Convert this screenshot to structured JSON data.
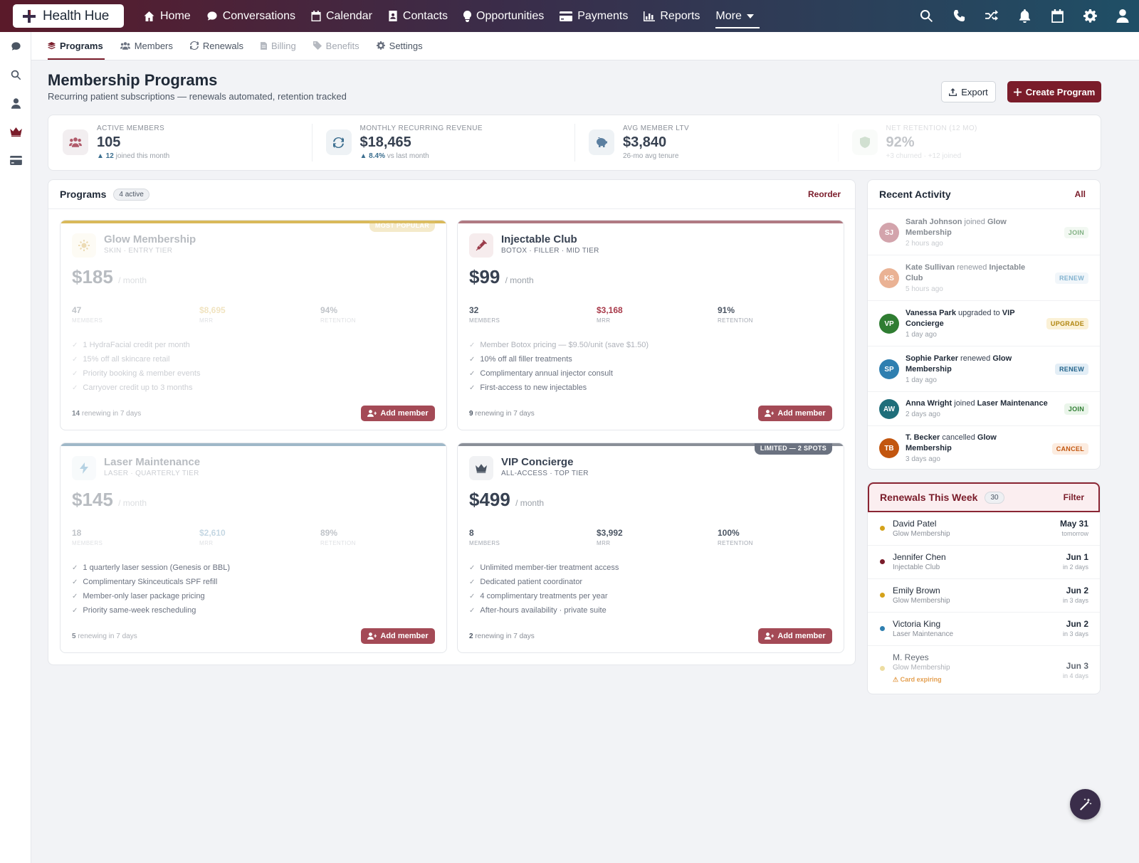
{
  "brand": {
    "name": "Health Hue"
  },
  "nav": {
    "items": [
      {
        "label": "Home",
        "icon": "home-icon"
      },
      {
        "label": "Conversations",
        "icon": "chat-icon"
      },
      {
        "label": "Calendar",
        "icon": "calendar-icon"
      },
      {
        "label": "Contacts",
        "icon": "contacts-icon"
      },
      {
        "label": "Opportunities",
        "icon": "lightbulb-icon"
      },
      {
        "label": "Payments",
        "icon": "credit-card-icon"
      },
      {
        "label": "Reports",
        "icon": "chart-icon"
      }
    ],
    "more": "More"
  },
  "subnav": {
    "items": [
      {
        "label": "Programs",
        "state": "active"
      },
      {
        "label": "Members",
        "state": "normal"
      },
      {
        "label": "Renewals",
        "state": "normal"
      },
      {
        "label": "Billing",
        "state": "disabled"
      },
      {
        "label": "Benefits",
        "state": "disabled"
      },
      {
        "label": "Settings",
        "state": "normal"
      }
    ]
  },
  "header": {
    "title": "Membership Programs",
    "subtitle": "Recurring patient subscriptions — renewals automated, retention tracked",
    "export_label": "Export",
    "create_label": "Create Program"
  },
  "stats": [
    {
      "label": "ACTIVE MEMBERS",
      "value": "105",
      "delta": "▲ 12",
      "note": "joined this month"
    },
    {
      "label": "MONTHLY RECURRING REVENUE",
      "value": "$18,465",
      "delta": "▲ 8.4%",
      "note": "vs last month"
    },
    {
      "label": "AVG MEMBER LTV",
      "value": "$3,840",
      "delta": "",
      "note": "26-mo avg tenure"
    },
    {
      "label": "NET RETENTION (12 MO)",
      "value": "92%",
      "delta": "",
      "note": "+3 churned · +12 joined"
    }
  ],
  "programs": {
    "title": "Programs",
    "badge": "4 active",
    "reorder": "Reorder",
    "add_label": "Add member",
    "metric_labels": {
      "members": "MEMBERS",
      "mrr": "MRR",
      "retention": "RETENTION"
    },
    "per": "/ month",
    "renewing_suffix": "renewing in 7 days",
    "cards": [
      {
        "name": "Glow Membership",
        "tier": "SKIN · ENTRY TIER",
        "price": "$185",
        "members": "47",
        "mrr": "$8,695",
        "retention": "94%",
        "renewing": "14",
        "ribbon": "MOST POPULAR",
        "accent": "#d9b95a",
        "benefits": [
          "1 HydraFacial credit per month",
          "15% off all skincare retail",
          "Priority booking & member events",
          "Carryover credit up to 3 months"
        ]
      },
      {
        "name": "Injectable Club",
        "tier": "BOTOX · FILLER · MID TIER",
        "price": "$99",
        "members": "32",
        "mrr": "$3,168",
        "retention": "91%",
        "renewing": "9",
        "ribbon": "",
        "accent": "#b07a82",
        "benefits": [
          "Member Botox pricing — $9.50/unit (save $1.50)",
          "10% off all filler treatments",
          "Complimentary annual injector consult",
          "First-access to new injectables"
        ]
      },
      {
        "name": "Laser Maintenance",
        "tier": "LASER · QUARTERLY TIER",
        "price": "$145",
        "members": "18",
        "mrr": "$2,610",
        "retention": "89%",
        "renewing": "5",
        "ribbon": "",
        "accent": "#9fb8c8",
        "benefits": [
          "1 quarterly laser session (Genesis or BBL)",
          "Complimentary Skinceuticals SPF refill",
          "Member-only laser package pricing",
          "Priority same-week rescheduling"
        ]
      },
      {
        "name": "VIP Concierge",
        "tier": "ALL-ACCESS · TOP TIER",
        "price": "$499",
        "members": "8",
        "mrr": "$3,992",
        "retention": "100%",
        "renewing": "2",
        "ribbon": "LIMITED — 2 SPOTS",
        "accent": "#8a8f98",
        "benefits": [
          "Unlimited member-tier treatment access",
          "Dedicated patient coordinator",
          "4 complimentary treatments per year",
          "After-hours availability · private suite"
        ]
      }
    ]
  },
  "activity": {
    "title": "Recent Activity",
    "all": "All",
    "items": [
      {
        "initials": "SJ",
        "name": "Sarah Johnson",
        "verb": "joined",
        "target": "Glow Membership",
        "time": "2 hours ago",
        "tag": "JOIN",
        "avatar_color": "#b05a6a"
      },
      {
        "initials": "KS",
        "name": "Kate Sullivan",
        "verb": "renewed",
        "target": "Injectable Club",
        "time": "5 hours ago",
        "tag": "RENEW",
        "avatar_color": "#d9743e"
      },
      {
        "initials": "VP",
        "name": "Vanessa Park",
        "verb": "upgraded to",
        "target": "VIP Concierge",
        "time": "1 day ago",
        "tag": "UPGRADE",
        "avatar_color": "#2f7d32"
      },
      {
        "initials": "SP",
        "name": "Sophie Parker",
        "verb": "renewed",
        "target": "Glow Membership",
        "time": "1 day ago",
        "tag": "RENEW",
        "avatar_color": "#2f7fb0"
      },
      {
        "initials": "AW",
        "name": "Anna Wright",
        "verb": "joined",
        "target": "Laser Maintenance",
        "time": "2 days ago",
        "tag": "JOIN",
        "avatar_color": "#1f6e7a"
      },
      {
        "initials": "TB",
        "name": "T. Becker",
        "verb": "cancelled",
        "target": "Glow Membership",
        "time": "3 days ago",
        "tag": "CANCEL",
        "avatar_color": "#c2560f"
      }
    ]
  },
  "renewals": {
    "title": "Renewals This Week",
    "count": "30",
    "filter": "Filter",
    "items": [
      {
        "name": "David Patel",
        "program": "Glow Membership",
        "date": "May 31",
        "relative": "tomorrow",
        "dot": "#d4a21a",
        "warning": ""
      },
      {
        "name": "Jennifer Chen",
        "program": "Injectable Club",
        "date": "Jun 1",
        "relative": "in 2 days",
        "dot": "#7a1c2a",
        "warning": ""
      },
      {
        "name": "Emily Brown",
        "program": "Glow Membership",
        "date": "Jun 2",
        "relative": "in 3 days",
        "dot": "#d4a21a",
        "warning": ""
      },
      {
        "name": "Victoria King",
        "program": "Laser Maintenance",
        "date": "Jun 2",
        "relative": "in 3 days",
        "dot": "#2f7fb0",
        "warning": ""
      },
      {
        "name": "M. Reyes",
        "program": "Glow Membership",
        "date": "Jun 3",
        "relative": "in 4 days",
        "dot": "#e6cf7a",
        "warning": "⚠ Card expiring"
      }
    ]
  }
}
